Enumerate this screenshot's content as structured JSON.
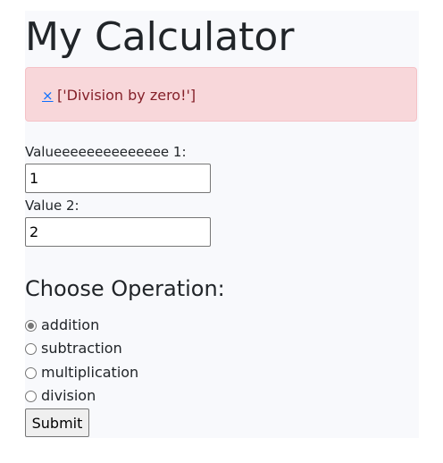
{
  "page": {
    "title": "My Calculator"
  },
  "alert": {
    "close_label": "×",
    "message": "['Division by zero!']",
    "colors": {
      "background": "#f8d7da",
      "border": "#f5c2c7",
      "text": "#842029",
      "close_link": "#0d6efd"
    }
  },
  "form": {
    "value1": {
      "label": "Valueeeeeeeeeeeeee 1:",
      "value": "1"
    },
    "value2": {
      "label": "Value 2:",
      "value": "2"
    },
    "operation": {
      "heading": "Choose Operation:",
      "options": [
        {
          "label": "addition",
          "checked": true
        },
        {
          "label": "subtraction",
          "checked": false
        },
        {
          "label": "multiplication",
          "checked": false
        },
        {
          "label": "division",
          "checked": false
        }
      ]
    },
    "submit_label": "Submit"
  }
}
